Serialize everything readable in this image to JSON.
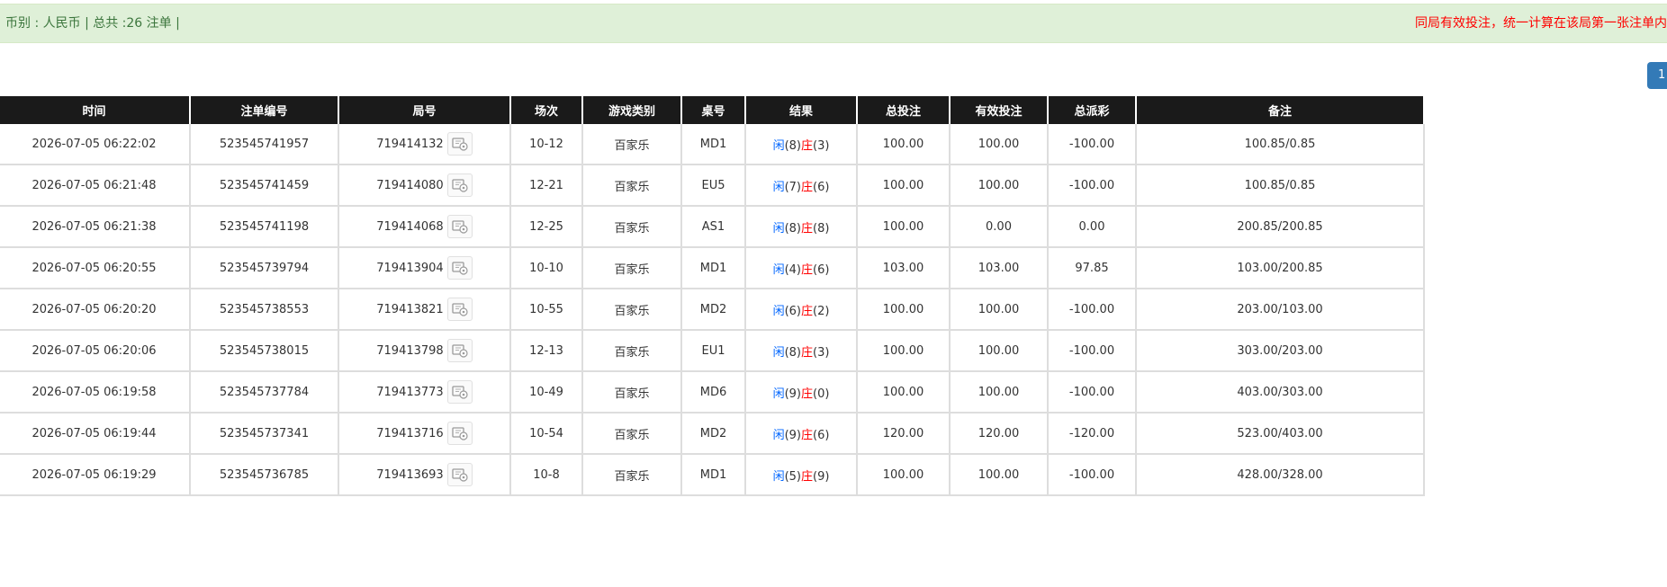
{
  "info_bar": {
    "summary": "币别 : 人民币 | 总共 :26 注单 |",
    "notice": "同局有效投注，统一计算在该局第一张注单内"
  },
  "pagination": {
    "current_page": "1"
  },
  "colors": {
    "info_bg": "#dff0d8",
    "header_bg": "#1a1a1a",
    "accent_blue": "#0066ff",
    "accent_red": "#ff0000",
    "page_btn": "#337ab7"
  },
  "table": {
    "headers": [
      "时间",
      "注单编号",
      "局号",
      "场次",
      "游戏类别",
      "桌号",
      "结果",
      "总投注",
      "有效投注",
      "总派彩",
      "备注"
    ],
    "rows": [
      {
        "time": "2026-07-05 06:22:02",
        "bet_id": "523545741957",
        "round_id": "719414132",
        "shoe": "10-12",
        "game": "百家乐",
        "table_no": "MD1",
        "player_label": "闲",
        "player_score": "(8)",
        "banker_label": "庄",
        "banker_score": "(3)",
        "total_bet": "100.00",
        "valid_bet": "100.00",
        "payout": "-100.00",
        "payout_color": "red",
        "note": "100.85/0.85"
      },
      {
        "time": "2026-07-05 06:21:48",
        "bet_id": "523545741459",
        "round_id": "719414080",
        "shoe": "12-21",
        "game": "百家乐",
        "table_no": "EU5",
        "player_label": "闲",
        "player_score": "(7)",
        "banker_label": "庄",
        "banker_score": "(6)",
        "total_bet": "100.00",
        "valid_bet": "100.00",
        "payout": "-100.00",
        "payout_color": "red",
        "note": "100.85/0.85"
      },
      {
        "time": "2026-07-05 06:21:38",
        "bet_id": "523545741198",
        "round_id": "719414068",
        "shoe": "12-25",
        "game": "百家乐",
        "table_no": "AS1",
        "player_label": "闲",
        "player_score": "(8)",
        "banker_label": "庄",
        "banker_score": "(8)",
        "total_bet": "100.00",
        "valid_bet": "0.00",
        "payout": "0.00",
        "payout_color": "normal",
        "note": "200.85/200.85"
      },
      {
        "time": "2026-07-05 06:20:55",
        "bet_id": "523545739794",
        "round_id": "719413904",
        "shoe": "10-10",
        "game": "百家乐",
        "table_no": "MD1",
        "player_label": "闲",
        "player_score": "(4)",
        "banker_label": "庄",
        "banker_score": "(6)",
        "total_bet": "103.00",
        "valid_bet": "103.00",
        "payout": "97.85",
        "payout_color": "normal",
        "note": "103.00/200.85"
      },
      {
        "time": "2026-07-05 06:20:20",
        "bet_id": "523545738553",
        "round_id": "719413821",
        "shoe": "10-55",
        "game": "百家乐",
        "table_no": "MD2",
        "player_label": "闲",
        "player_score": "(6)",
        "banker_label": "庄",
        "banker_score": "(2)",
        "total_bet": "100.00",
        "valid_bet": "100.00",
        "payout": "-100.00",
        "payout_color": "red",
        "note": "203.00/103.00"
      },
      {
        "time": "2026-07-05 06:20:06",
        "bet_id": "523545738015",
        "round_id": "719413798",
        "shoe": "12-13",
        "game": "百家乐",
        "table_no": "EU1",
        "player_label": "闲",
        "player_score": "(8)",
        "banker_label": "庄",
        "banker_score": "(3)",
        "total_bet": "100.00",
        "valid_bet": "100.00",
        "payout": "-100.00",
        "payout_color": "red",
        "note": "303.00/203.00"
      },
      {
        "time": "2026-07-05 06:19:58",
        "bet_id": "523545737784",
        "round_id": "719413773",
        "shoe": "10-49",
        "game": "百家乐",
        "table_no": "MD6",
        "player_label": "闲",
        "player_score": "(9)",
        "banker_label": "庄",
        "banker_score": "(0)",
        "total_bet": "100.00",
        "valid_bet": "100.00",
        "payout": "-100.00",
        "payout_color": "red",
        "note": "403.00/303.00"
      },
      {
        "time": "2026-07-05 06:19:44",
        "bet_id": "523545737341",
        "round_id": "719413716",
        "shoe": "10-54",
        "game": "百家乐",
        "table_no": "MD2",
        "player_label": "闲",
        "player_score": "(9)",
        "banker_label": "庄",
        "banker_score": "(6)",
        "total_bet": "120.00",
        "valid_bet": "120.00",
        "payout": "-120.00",
        "payout_color": "red",
        "note": "523.00/403.00"
      },
      {
        "time": "2026-07-05 06:19:29",
        "bet_id": "523545736785",
        "round_id": "719413693",
        "shoe": "10-8",
        "game": "百家乐",
        "table_no": "MD1",
        "player_label": "闲",
        "player_score": "(5)",
        "banker_label": "庄",
        "banker_score": "(9)",
        "total_bet": "100.00",
        "valid_bet": "100.00",
        "payout": "-100.00",
        "payout_color": "red",
        "note": "428.00/328.00"
      }
    ]
  }
}
